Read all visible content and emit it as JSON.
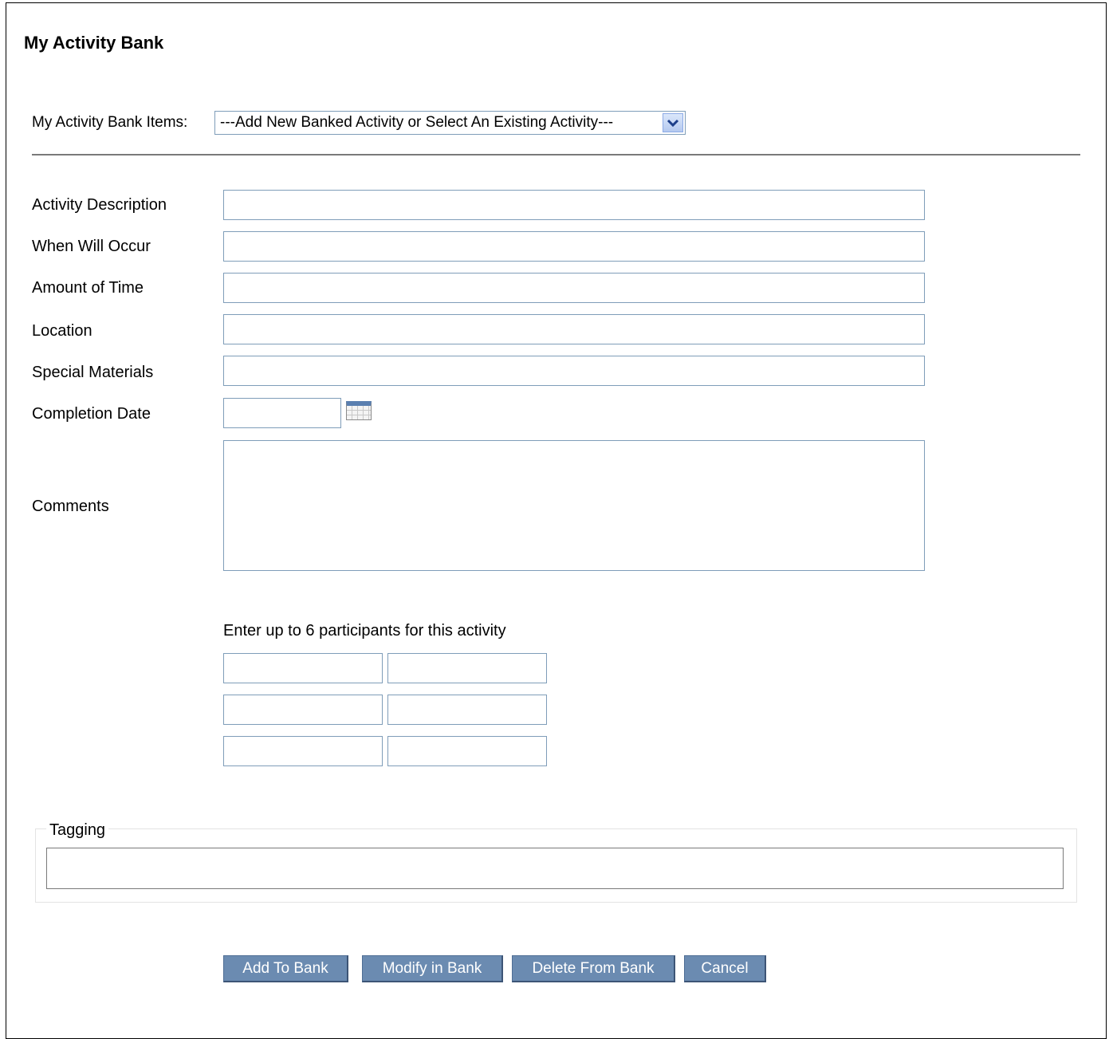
{
  "page": {
    "title": "My Activity Bank"
  },
  "bank_select": {
    "label": "My Activity Bank Items:",
    "selected": "---Add New Banked Activity or Select An Existing Activity---",
    "dropdown_icon": "chevron-down-icon"
  },
  "form": {
    "activity_description": {
      "label": "Activity  Description",
      "value": ""
    },
    "when_will_occur": {
      "label": "When Will Occur",
      "value": ""
    },
    "amount_of_time": {
      "label": "Amount of Time",
      "value": ""
    },
    "location": {
      "label": "Location",
      "value": ""
    },
    "special_materials": {
      "label": "Special Materials",
      "value": ""
    },
    "completion_date": {
      "label": "Completion Date",
      "value": "",
      "calendar_icon": "calendar-icon"
    },
    "comments": {
      "label": "Comments",
      "value": ""
    }
  },
  "participants": {
    "instruction": "Enter up to 6 participants for this activity",
    "values": [
      "",
      "",
      "",
      "",
      "",
      ""
    ]
  },
  "tagging": {
    "legend": "Tagging",
    "value": ""
  },
  "buttons": {
    "add": "Add To Bank",
    "modify": "Modify in Bank",
    "delete": "Delete From Bank",
    "cancel": "Cancel"
  },
  "colors": {
    "button_bg": "#6b8bb1",
    "input_border": "#7f9db9",
    "divider": "#7a7a7a"
  }
}
